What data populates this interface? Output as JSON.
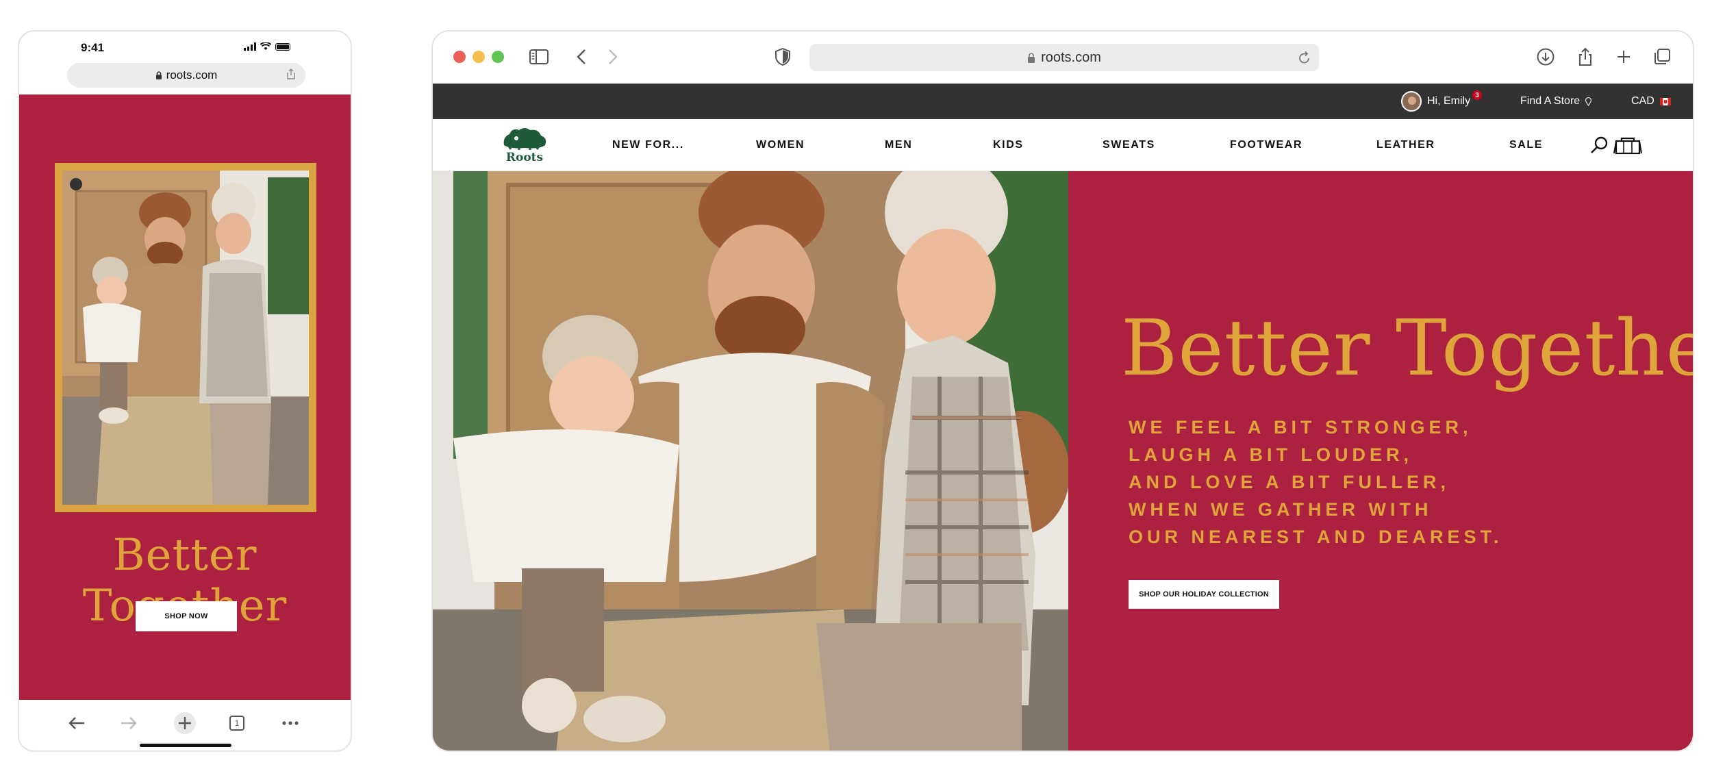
{
  "phone": {
    "time": "9:41",
    "url": "roots.com",
    "hero_title": "Better Together",
    "shop_button": "SHOP NOW",
    "tab_count": "1"
  },
  "browser": {
    "url": "roots.com",
    "util": {
      "greeting": "Hi, Emily",
      "badge_count": "3",
      "find_store": "Find A Store",
      "currency": "CAD"
    },
    "logo_text": "Roots",
    "nav": [
      "NEW FOR...",
      "WOMEN",
      "MEN",
      "KIDS",
      "SWEATS",
      "FOOTWEAR",
      "LEATHER",
      "SALE"
    ],
    "hero": {
      "title": "Better Together",
      "lines": [
        "WE FEEL A BIT STRONGER,",
        "LAUGH A BIT LOUDER,",
        "AND LOVE A BIT FULLER,",
        "WHEN WE GATHER WITH",
        "OUR NEAREST AND DEAREST."
      ],
      "button": "SHOP OUR HOLIDAY COLLECTION"
    }
  },
  "colors": {
    "brand_red": "#ad2140",
    "gold": "#e0a53a",
    "util_bar": "#323232",
    "logo_green": "#1f5b3a"
  },
  "icons": [
    "lock-icon",
    "share-icon",
    "back-arrow-icon",
    "forward-arrow-icon",
    "new-tab-plus-icon",
    "tabs-icon",
    "more-icon",
    "sidebar-icon",
    "shield-icon",
    "reload-icon",
    "download-icon",
    "search-icon",
    "cart-icon",
    "location-pin-icon",
    "canada-flag-icon"
  ]
}
